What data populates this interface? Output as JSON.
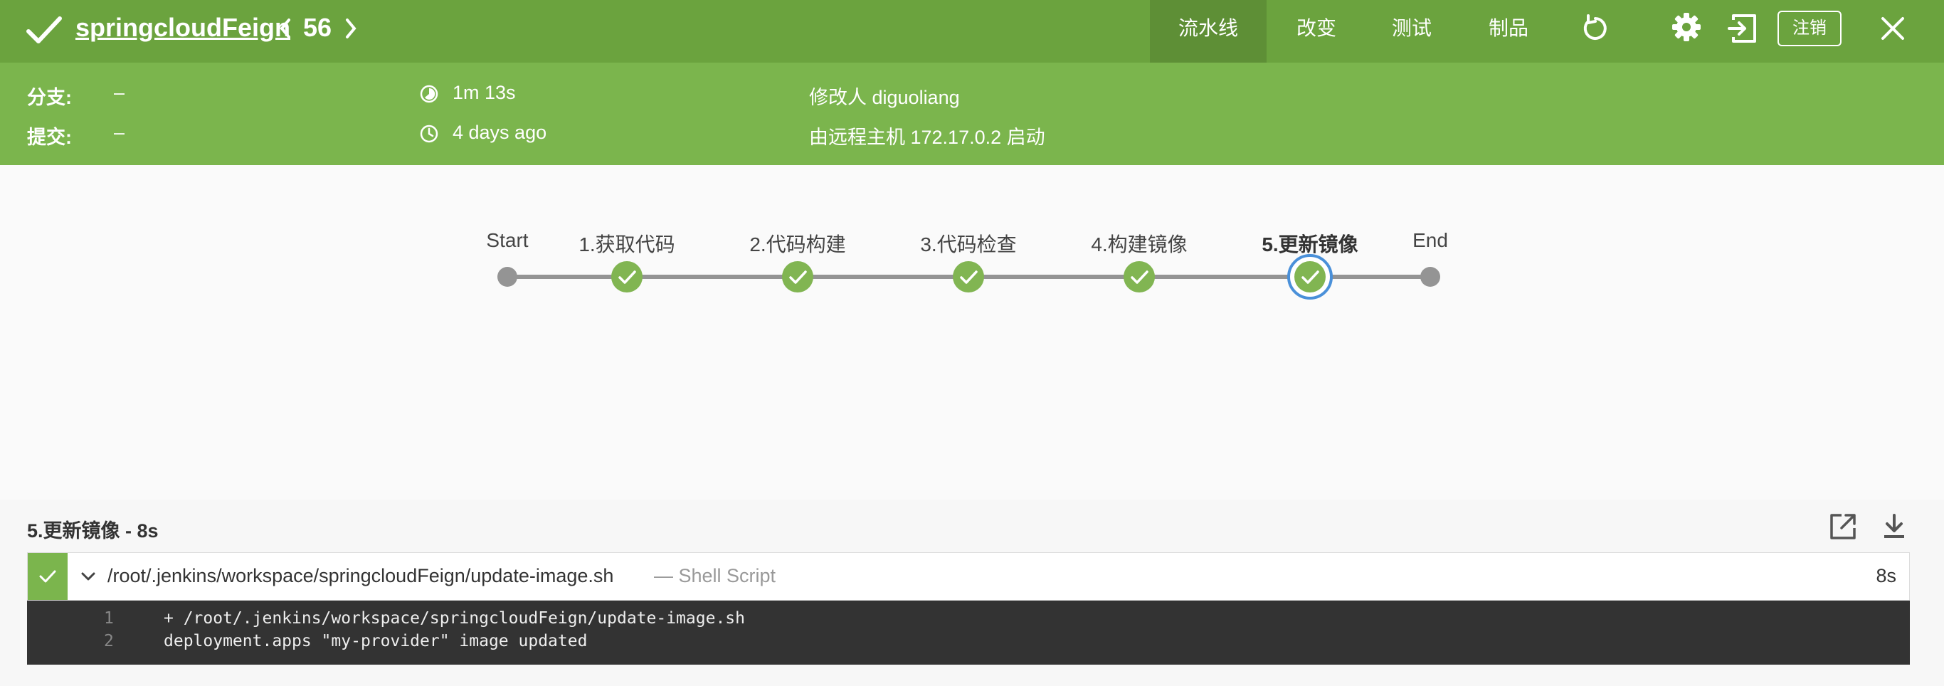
{
  "header": {
    "job_name": "springcloudFeign",
    "run_number": "56",
    "tabs": [
      "流水线",
      "改变",
      "测试",
      "制品"
    ],
    "logout_label": "注销"
  },
  "info": {
    "branch_label": "分支:",
    "branch_value": "–",
    "commit_label": "提交:",
    "commit_value": "–",
    "duration": "1m 13s",
    "time_ago": "4 days ago",
    "changes_by": "修改人 diguoliang",
    "started_by": "由远程主机 172.17.0.2 启动"
  },
  "pipeline": {
    "stages": [
      "Start",
      "1.获取代码",
      "2.代码构建",
      "3.代码检查",
      "4.构建镜像",
      "5.更新镜像",
      "End"
    ],
    "selected_stage": "5.更新镜像",
    "success_color": "#81b552"
  },
  "log": {
    "title": "5.更新镜像 - 8s",
    "step_path": "/root/.jenkins/workspace/springcloudFeign/update-image.sh",
    "step_type": "— Shell Script",
    "step_duration": "8s",
    "lines": [
      {
        "num": "1",
        "text": "+ /root/.jenkins/workspace/springcloudFeign/update-image.sh"
      },
      {
        "num": "2",
        "text": "deployment.apps \"my-provider\" image updated"
      }
    ]
  }
}
